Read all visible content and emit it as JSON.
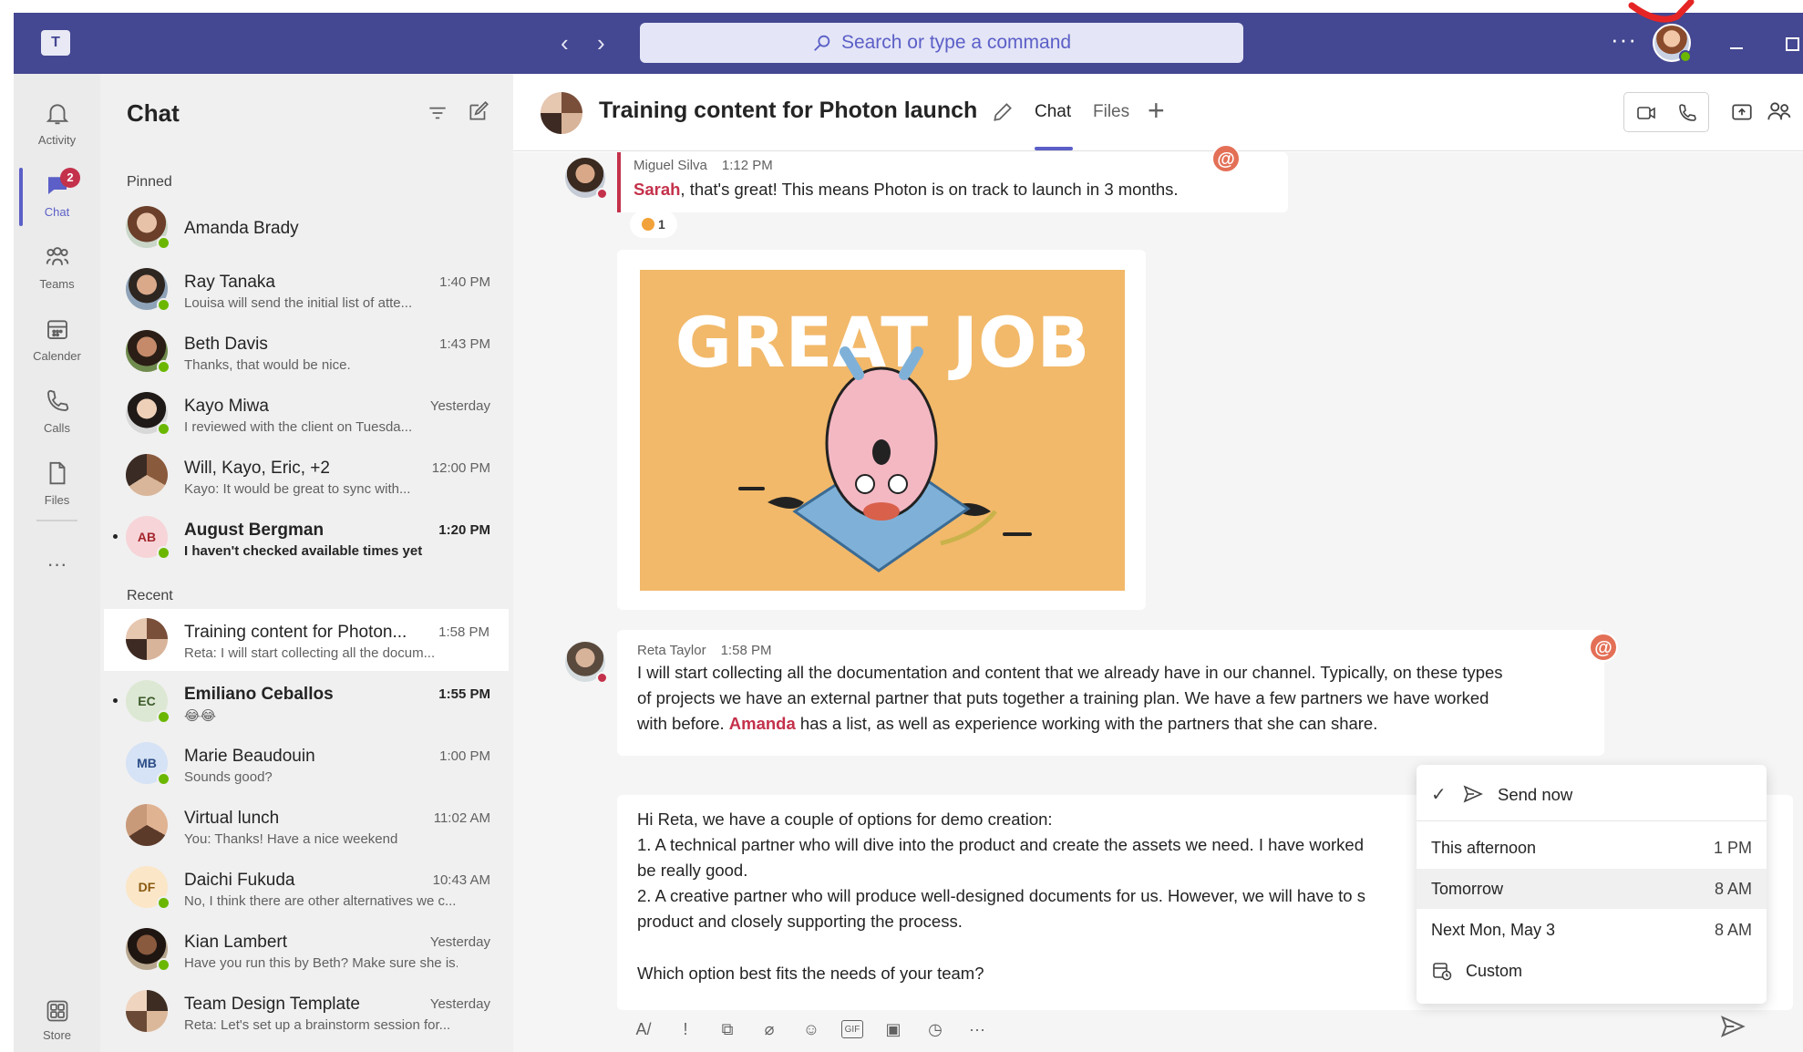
{
  "search": {
    "placeholder": "Search or type a command"
  },
  "titlebar": {
    "more": "···",
    "logo": "T"
  },
  "rail": {
    "items": [
      {
        "label": "Activity",
        "icon": "bell-icon"
      },
      {
        "label": "Chat",
        "icon": "chat-icon",
        "badge": "2"
      },
      {
        "label": "Teams",
        "icon": "teams-icon"
      },
      {
        "label": "Calender",
        "icon": "calendar-icon"
      },
      {
        "label": "Calls",
        "icon": "phone-icon"
      },
      {
        "label": "Files",
        "icon": "file-icon"
      }
    ],
    "more": "···",
    "store": "Store"
  },
  "chatlist": {
    "title": "Chat",
    "pinned_label": "Pinned",
    "recent_label": "Recent",
    "pinned": [
      {
        "name": "Amanda Brady",
        "time": "",
        "preview": ""
      },
      {
        "name": "Ray Tanaka",
        "time": "1:40 PM",
        "preview": "Louisa will send the initial list of atte..."
      },
      {
        "name": "Beth Davis",
        "time": "1:43 PM",
        "preview": "Thanks, that would be nice."
      },
      {
        "name": "Kayo Miwa",
        "time": "Yesterday",
        "preview": "I reviewed with the client on Tuesda..."
      },
      {
        "name": "Will, Kayo, Eric, +2",
        "time": "12:00 PM",
        "preview": "Kayo: It would be great to sync with..."
      },
      {
        "name": "August Bergman",
        "time": "1:20 PM",
        "preview": "I haven't checked available times yet",
        "initials": "AB"
      }
    ],
    "recent": [
      {
        "name": "Training content for Photon...",
        "time": "1:58 PM",
        "preview": "Reta: I will start collecting all the docum..."
      },
      {
        "name": "Emiliano Ceballos",
        "time": "1:55 PM",
        "preview": "😂😂",
        "initials": "EC"
      },
      {
        "name": "Marie Beaudouin",
        "time": "1:00 PM",
        "preview": "Sounds good?",
        "initials": "MB"
      },
      {
        "name": "Virtual lunch",
        "time": "11:02 AM",
        "preview": "You: Thanks! Have a nice weekend"
      },
      {
        "name": "Daichi Fukuda",
        "time": "10:43 AM",
        "preview": "No, I think there are other alternatives we c...",
        "initials": "DF"
      },
      {
        "name": "Kian Lambert",
        "time": "Yesterday",
        "preview": "Have you run this by Beth? Make sure she is..."
      },
      {
        "name": "Team Design Template",
        "time": "Yesterday",
        "preview": "Reta: Let's set up a brainstorm session for..."
      }
    ]
  },
  "header": {
    "title": "Training content for Photon launch",
    "tabs": [
      "Chat",
      "Files"
    ],
    "plus": "+"
  },
  "messages": [
    {
      "author": "Miguel Silva",
      "time": "1:12 PM",
      "mention": "Sarah",
      "text": ", that's great! This means Photon is on track to launch in 3 months.",
      "reaction_count": "1",
      "reaction_icon": "clapping-hands-icon"
    },
    {
      "gif_text": "GREAT JOB"
    },
    {
      "author": "Reta Taylor",
      "time": "1:58 PM",
      "line1": "I will start collecting all the documentation and content that we already have in our channel. Typically, on these types",
      "line2": "of projects we have an external partner that puts together a training plan. We have a few partners we have worked",
      "line3_pre": "with before. ",
      "mention": "Amanda",
      "line3_post": " has a list, as well as experience working with the partners that she can share."
    }
  ],
  "compose": {
    "lines": [
      "Hi Reta, we have a couple of options for demo creation:",
      "1. A technical partner who will dive into the product and create the assets we need. I have worked",
      "be really good.",
      "2. A creative partner who will produce well-designed documents for us. However, we will have to s",
      "product and closely supporting the process.",
      "Which option best fits the needs of your team?"
    ]
  },
  "schedule_menu": {
    "send_now": "Send now",
    "check": "✓",
    "options": [
      {
        "label": "This afternoon",
        "time": "1 PM"
      },
      {
        "label": "Tomorrow",
        "time": "8 AM"
      },
      {
        "label": "Next Mon, May 3",
        "time": "8 AM"
      }
    ],
    "custom": "Custom"
  },
  "colors": {
    "brand": "#444791",
    "accent": "#5b5fc7",
    "mention": "#c4314b",
    "presence_available": "#6bb700",
    "presence_busy": "#c4314b"
  }
}
